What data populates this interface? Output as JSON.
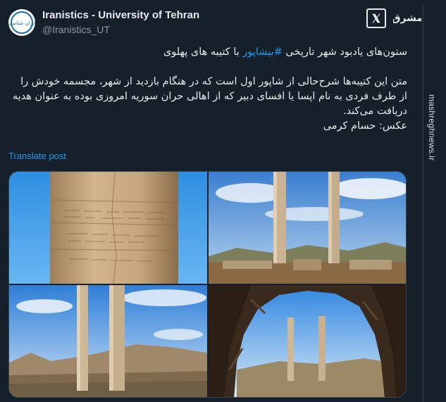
{
  "author": {
    "name": "Iranistics - University of Tehran",
    "handle": "@Iranistics_UT",
    "avatar_text": "ایران شناسی"
  },
  "brand": {
    "logo_text": "مشرق",
    "watermark": "mashreghnews.ir"
  },
  "tweet": {
    "line1_before": "ستون‌های یادبود شهر تاریخی ",
    "hashtag": "#بیشاپور",
    "line1_after": " با کتیبه های پهلوی",
    "paragraph2": "متن این کتیبه‌ها شرح‌حالی از شاپور اول است که در هنگام بازدید از شهر، مجسمه خودش را از طرف فردی به نام اپسا یا افسای دبیر که از اهالی حران سوریه امروزی بوده به عنوان هدیه دریافت می‌کند.",
    "photo_credit": "عکس: حسام کرمی",
    "translate_label": "Translate post"
  },
  "photos": [
    {
      "name": "column-inscription-closeup"
    },
    {
      "name": "two-columns-ruins"
    },
    {
      "name": "two-columns-mountains"
    },
    {
      "name": "columns-through-cave"
    }
  ],
  "colors": {
    "background": "#15202b",
    "text": "#e7e9ea",
    "muted": "#8b98a5",
    "link": "#1d9bf0",
    "border": "#38444d"
  }
}
